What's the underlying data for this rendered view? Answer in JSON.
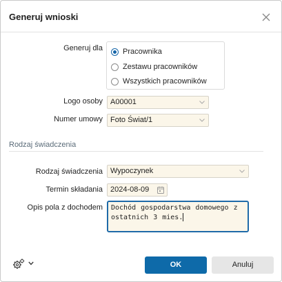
{
  "dialog": {
    "title": "Generuj wnioski",
    "close_icon": "close-icon"
  },
  "generate_for": {
    "label": "Generuj dla",
    "options": [
      {
        "label": "Pracownika",
        "checked": true
      },
      {
        "label": "Zestawu pracowników",
        "checked": false
      },
      {
        "label": "Wszystkich pracowników",
        "checked": false
      }
    ]
  },
  "person_logo": {
    "label": "Logo osoby",
    "value": "A00001"
  },
  "contract_number": {
    "label": "Numer umowy",
    "value": "Foto Świat/1"
  },
  "benefit_section": {
    "title": "Rodzaj świadczenia"
  },
  "benefit_type": {
    "label": "Rodzaj świadczenia",
    "value": "Wypoczynek"
  },
  "submission_date": {
    "label": "Termin składania",
    "value": "2024-08-09"
  },
  "income_field": {
    "label": "Opis pola z dochodem",
    "value": "Dochód gospodarstwa domowego z ostatnich 3 mies."
  },
  "footer": {
    "ok_label": "OK",
    "cancel_label": "Anuluj",
    "settings_icon": "gear-icon"
  },
  "colors": {
    "accent": "#0e6aa9",
    "input_bg": "#fbf6e9",
    "section_title": "#5a6b78"
  }
}
